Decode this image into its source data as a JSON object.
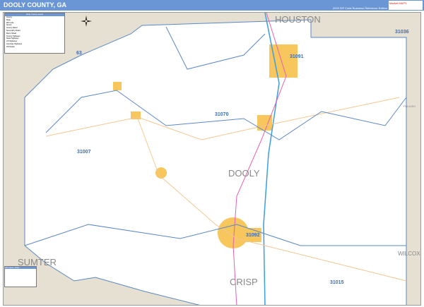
{
  "header": {
    "title": "DOOLY COUNTY, GA",
    "edition": "2020 ZIP Code Business Reference Edition",
    "logo": "Market MAPS"
  },
  "map": {
    "county_label": "DOOLY",
    "neighbors": {
      "north": "HOUSTON",
      "west": "SUMTER",
      "south": "CRISP",
      "east": "WILCOX",
      "northeast": "PULASKI"
    },
    "zip_codes": [
      "31036",
      "31091",
      "31070",
      "31007",
      "31092",
      "31015"
    ],
    "highway_shield": "63",
    "colors": {
      "land": "#ffffff",
      "surrounding": "#e6e0d2",
      "zip_border": "#5a88c6",
      "cities": "#f7c65c",
      "us_hwy": "#e860b0",
      "interstate": "#3a9ee0",
      "state_hwy": "#f5c790",
      "header": "#6a96d6"
    }
  },
  "legend": {
    "title": "Dooly County Legend",
    "items": [
      "County",
      "State",
      "ZIP Code",
      "Airport",
      "County Shield",
      "Secondary Shield",
      "Metro Shield",
      "County Highways",
      "State Highways",
      "US Highways",
      "Interstate Highways",
      "Toll Roads"
    ]
  },
  "zip_table": {
    "title": "ZIP Codes / Cities"
  }
}
